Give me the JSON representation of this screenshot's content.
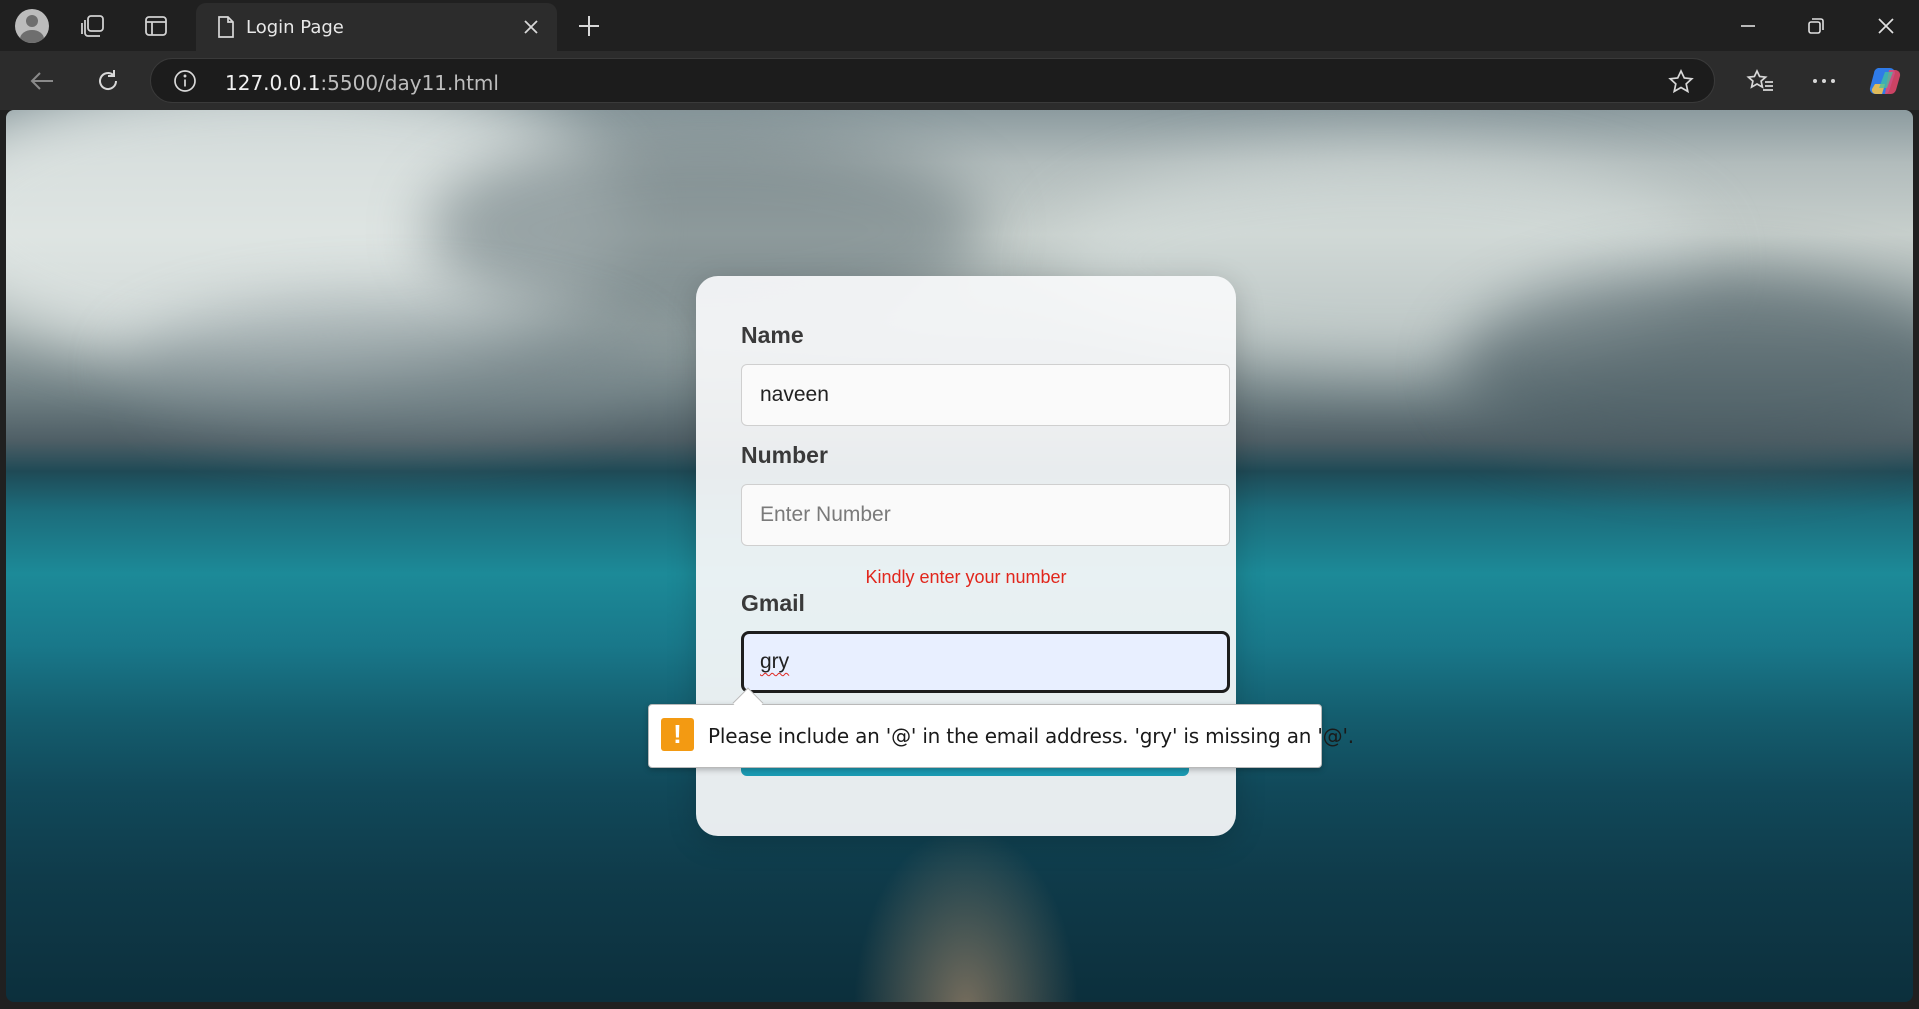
{
  "browser": {
    "tab_title": "Login Page",
    "url_host": "127.0.0.1",
    "url_rest": ":5500/day11.html"
  },
  "form": {
    "name_label": "Name",
    "name_value": "naveen",
    "number_label": "Number",
    "number_placeholder": "Enter Number",
    "number_error": "Kindly enter your number",
    "gmail_label": "Gmail",
    "gmail_value": "gry"
  },
  "validation": {
    "message": "Please include an '@' in the email address. 'gry' is missing an '@'.",
    "icon": "!"
  },
  "colors": {
    "error": "#e1261c",
    "warning": "#f39a12",
    "submit_accent": "#1b9bb3"
  }
}
